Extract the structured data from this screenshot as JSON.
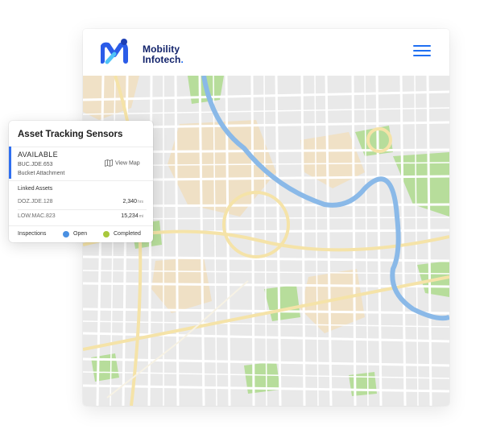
{
  "header": {
    "brand_line1": "Mobility",
    "brand_line2": "Infotech",
    "brand_dot": ".",
    "menu_icon": "hamburger-menu-icon",
    "logo_icon": "mobility-infotech-logo"
  },
  "card": {
    "title": "Asset Tracking Sensors",
    "status": "AVAILABLE",
    "asset_id": "BUC.JDE.653",
    "asset_name": "Bucket Attachment",
    "view_map": "View Map",
    "view_map_icon": "map-icon",
    "linked_title": "Linked Assets",
    "linked": [
      {
        "id": "DOZ.JDE.128",
        "value": "2,340",
        "unit": "hrs"
      },
      {
        "id": "LOW.MAC.823",
        "value": "15,234",
        "unit": "mi"
      }
    ],
    "inspections_label": "Inspections",
    "open_label": "Open",
    "completed_label": "Completed"
  },
  "colors": {
    "accent": "#2f6ff0",
    "brand_text": "#12236b",
    "open": "#4a90e2",
    "completed": "#a8c83c",
    "map_base": "#e9e9e9",
    "river": "#8ab9e8",
    "park": "#b7dd9b",
    "district": "#f1dfbf"
  }
}
